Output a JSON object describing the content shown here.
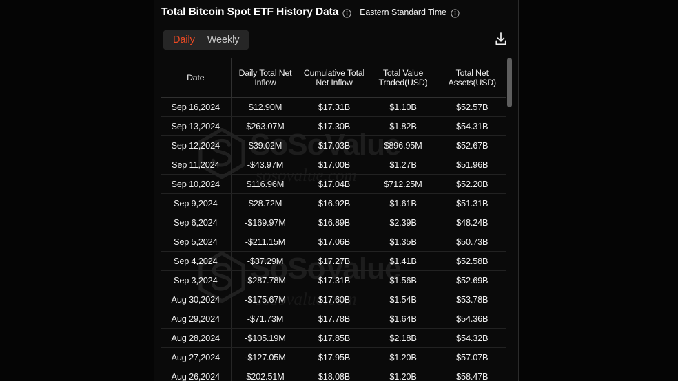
{
  "panel": {
    "title": "Total Bitcoin Spot ETF History Data",
    "timezone_label": "Eastern Standard Time",
    "title_info_icon": "info-circle-icon",
    "timezone_info_icon": "info-circle-icon",
    "download_icon": "download-icon"
  },
  "toggle": {
    "daily_label": "Daily",
    "weekly_label": "Weekly",
    "active": "Daily"
  },
  "colors": {
    "accent": "#f04a23",
    "positive": "#1fc25c",
    "negative": "#f02b1d",
    "panel_bg": "#0a0a0a",
    "page_bg": "#050505",
    "toggle_bg": "#262626"
  },
  "watermark": {
    "brand": "SoSoValue",
    "domain": "sosovalue.com"
  },
  "table": {
    "columns": [
      "Date",
      "Daily Total Net Inflow",
      "Cumulative Total Net Inflow",
      "Total Value Traded(USD)",
      "Total Net Assets(USD)"
    ],
    "rows": [
      {
        "date": "Sep 16,2024",
        "daily_net_inflow": "$12.90M",
        "daily_sign": "pos",
        "cumulative_net_inflow": "$17.31B",
        "total_value_traded": "$1.10B",
        "total_net_assets": "$52.57B"
      },
      {
        "date": "Sep 13,2024",
        "daily_net_inflow": "$263.07M",
        "daily_sign": "pos",
        "cumulative_net_inflow": "$17.30B",
        "total_value_traded": "$1.82B",
        "total_net_assets": "$54.31B"
      },
      {
        "date": "Sep 12,2024",
        "daily_net_inflow": "$39.02M",
        "daily_sign": "pos",
        "cumulative_net_inflow": "$17.03B",
        "total_value_traded": "$896.95M",
        "total_net_assets": "$52.67B"
      },
      {
        "date": "Sep 11,2024",
        "daily_net_inflow": "-$43.97M",
        "daily_sign": "neg",
        "cumulative_net_inflow": "$17.00B",
        "total_value_traded": "$1.27B",
        "total_net_assets": "$51.96B"
      },
      {
        "date": "Sep 10,2024",
        "daily_net_inflow": "$116.96M",
        "daily_sign": "pos",
        "cumulative_net_inflow": "$17.04B",
        "total_value_traded": "$712.25M",
        "total_net_assets": "$52.20B"
      },
      {
        "date": "Sep 9,2024",
        "daily_net_inflow": "$28.72M",
        "daily_sign": "pos",
        "cumulative_net_inflow": "$16.92B",
        "total_value_traded": "$1.61B",
        "total_net_assets": "$51.31B"
      },
      {
        "date": "Sep 6,2024",
        "daily_net_inflow": "-$169.97M",
        "daily_sign": "neg",
        "cumulative_net_inflow": "$16.89B",
        "total_value_traded": "$2.39B",
        "total_net_assets": "$48.24B"
      },
      {
        "date": "Sep 5,2024",
        "daily_net_inflow": "-$211.15M",
        "daily_sign": "neg",
        "cumulative_net_inflow": "$17.06B",
        "total_value_traded": "$1.35B",
        "total_net_assets": "$50.73B"
      },
      {
        "date": "Sep 4,2024",
        "daily_net_inflow": "-$37.29M",
        "daily_sign": "neg",
        "cumulative_net_inflow": "$17.27B",
        "total_value_traded": "$1.41B",
        "total_net_assets": "$52.58B"
      },
      {
        "date": "Sep 3,2024",
        "daily_net_inflow": "-$287.78M",
        "daily_sign": "neg",
        "cumulative_net_inflow": "$17.31B",
        "total_value_traded": "$1.56B",
        "total_net_assets": "$52.69B"
      },
      {
        "date": "Aug 30,2024",
        "daily_net_inflow": "-$175.67M",
        "daily_sign": "neg",
        "cumulative_net_inflow": "$17.60B",
        "total_value_traded": "$1.54B",
        "total_net_assets": "$53.78B"
      },
      {
        "date": "Aug 29,2024",
        "daily_net_inflow": "-$71.73M",
        "daily_sign": "neg",
        "cumulative_net_inflow": "$17.78B",
        "total_value_traded": "$1.64B",
        "total_net_assets": "$54.36B"
      },
      {
        "date": "Aug 28,2024",
        "daily_net_inflow": "-$105.19M",
        "daily_sign": "neg",
        "cumulative_net_inflow": "$17.85B",
        "total_value_traded": "$2.18B",
        "total_net_assets": "$54.32B"
      },
      {
        "date": "Aug 27,2024",
        "daily_net_inflow": "-$127.05M",
        "daily_sign": "neg",
        "cumulative_net_inflow": "$17.95B",
        "total_value_traded": "$1.20B",
        "total_net_assets": "$57.07B"
      },
      {
        "date": "Aug 26,2024",
        "daily_net_inflow": "$202.51M",
        "daily_sign": "pos",
        "cumulative_net_inflow": "$18.08B",
        "total_value_traded": "$1.20B",
        "total_net_assets": "$58.47B"
      }
    ]
  }
}
